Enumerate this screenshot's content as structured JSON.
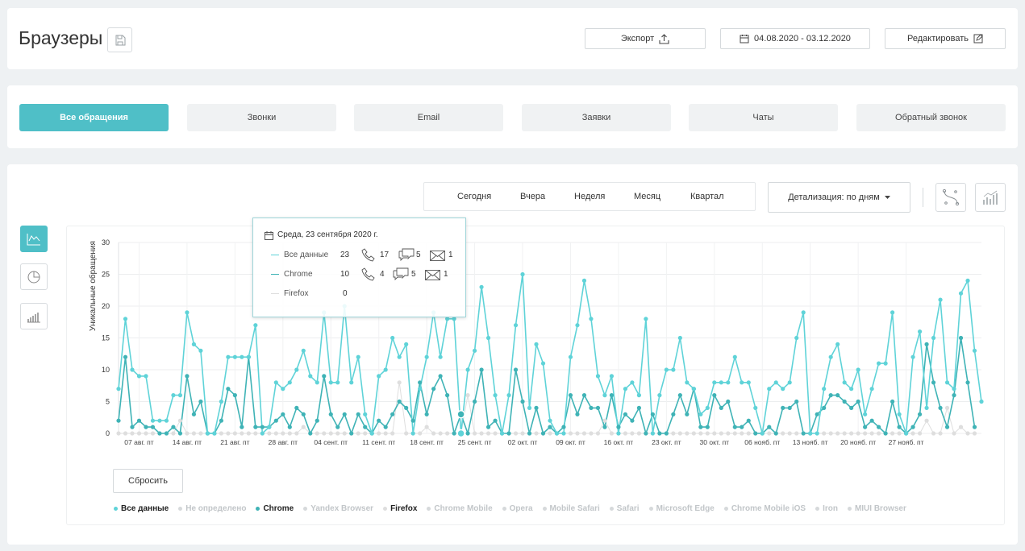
{
  "header": {
    "title": "Браузеры",
    "export_label": "Экспорт",
    "date_range": "04.08.2020 - 03.12.2020",
    "edit_label": "Редактировать"
  },
  "tabs": [
    {
      "label": "Все обращения",
      "active": true
    },
    {
      "label": "Звонки",
      "active": false
    },
    {
      "label": "Email",
      "active": false
    },
    {
      "label": "Заявки",
      "active": false
    },
    {
      "label": "Чаты",
      "active": false
    },
    {
      "label": "Обратный звонок",
      "active": false
    }
  ],
  "periods": [
    "Сегодня",
    "Вчера",
    "Неделя",
    "Месяц",
    "Квартал"
  ],
  "detail_label": "Детализация: по дням",
  "reset_label": "Сбросить",
  "tooltip": {
    "date": "Среда, 23 сентября 2020 г.",
    "rows": [
      {
        "name": "Все данные",
        "total": "23",
        "calls": "17",
        "chats": "5",
        "emails": "1"
      },
      {
        "name": "Chrome",
        "total": "10",
        "calls": "4",
        "chats": "5",
        "emails": "1"
      },
      {
        "name": "Firefox",
        "total": "0"
      }
    ]
  },
  "colors": {
    "accent": "#4fbfc7",
    "all_data": "#5fd3d8",
    "chrome": "#3fb3b6",
    "firefox": "#dedede",
    "inactive": "#d6d9db"
  },
  "legend": [
    {
      "label": "Все данные",
      "active": true,
      "color": "#5fd3d8"
    },
    {
      "label": "Не определено",
      "active": false,
      "color": "#d6d9db"
    },
    {
      "label": "Chrome",
      "active": true,
      "color": "#3fb3b6"
    },
    {
      "label": "Yandex Browser",
      "active": false,
      "color": "#d6d9db"
    },
    {
      "label": "Firefox",
      "active": true,
      "color": "#dedede"
    },
    {
      "label": "Chrome Mobile",
      "active": false,
      "color": "#d6d9db"
    },
    {
      "label": "Opera",
      "active": false,
      "color": "#d6d9db"
    },
    {
      "label": "Mobile Safari",
      "active": false,
      "color": "#d6d9db"
    },
    {
      "label": "Safari",
      "active": false,
      "color": "#d6d9db"
    },
    {
      "label": "Microsoft Edge",
      "active": false,
      "color": "#d6d9db"
    },
    {
      "label": "Chrome Mobile iOS",
      "active": false,
      "color": "#d6d9db"
    },
    {
      "label": "Iron",
      "active": false,
      "color": "#d6d9db"
    },
    {
      "label": "MIUI Browser",
      "active": false,
      "color": "#d6d9db"
    }
  ],
  "chart_data": {
    "type": "line",
    "ylabel": "Уникальные обращения",
    "ylim": [
      0,
      30
    ],
    "yticks": [
      0,
      5,
      10,
      15,
      20,
      25,
      30
    ],
    "xtick_labels": [
      "07 авг. пт",
      "14 авг. пт",
      "21 авг. пт",
      "28 авг. пт",
      "04 сент. пт",
      "11 сент. пт",
      "18 сент. пт",
      "25 сент. пт",
      "02 окт. пт",
      "09 окт. пт",
      "16 окт. пт",
      "23 окт. пт",
      "30 окт. пт",
      "06 нояб. пт",
      "13 нояб. пт",
      "20 нояб. пт",
      "27 нояб. пт"
    ],
    "x_start": "04.08.2020",
    "x_end": "03.12.2020",
    "grid": true,
    "series": [
      {
        "name": "Все данные",
        "values": [
          7,
          18,
          10,
          9,
          9,
          2,
          2,
          2,
          6,
          6,
          19,
          14,
          13,
          0,
          0,
          5,
          12,
          12,
          12,
          12,
          17,
          0,
          1,
          8,
          7,
          8,
          10,
          13,
          9,
          8,
          19,
          8,
          8,
          20,
          8,
          12,
          3,
          0,
          9,
          10,
          15,
          12,
          14,
          0,
          7,
          12,
          19,
          12,
          18,
          18,
          0,
          10,
          13,
          23,
          15,
          6,
          0,
          6,
          17,
          25,
          4,
          14,
          11,
          2,
          0,
          0,
          12,
          17,
          24,
          18,
          9,
          6,
          9,
          0,
          7,
          8,
          6,
          18,
          0,
          6,
          10,
          10,
          15,
          8,
          7,
          3,
          4,
          8,
          8,
          8,
          12,
          8,
          8,
          4,
          0,
          7,
          8,
          7,
          8,
          15,
          19,
          0,
          0,
          7,
          12,
          14,
          8,
          7,
          10,
          3,
          7,
          11,
          11,
          19,
          3,
          0,
          12,
          16,
          4,
          15,
          21,
          8,
          7,
          22,
          24,
          13,
          5
        ]
      },
      {
        "name": "Chrome",
        "values": [
          2,
          12,
          1,
          2,
          1,
          1,
          0,
          0,
          1,
          0,
          9,
          3,
          5,
          0,
          0,
          2,
          7,
          6,
          1,
          12,
          1,
          1,
          1,
          2,
          3,
          1,
          4,
          3,
          0,
          2,
          9,
          3,
          1,
          3,
          0,
          3,
          1,
          0,
          2,
          1,
          3,
          5,
          4,
          2,
          8,
          3,
          7,
          9,
          6,
          0,
          3,
          0,
          5,
          10,
          1,
          2,
          0,
          0,
          10,
          5,
          0,
          4,
          0,
          1,
          0,
          1,
          6,
          3,
          6,
          4,
          4,
          1,
          6,
          1,
          3,
          2,
          4,
          0,
          3,
          0,
          0,
          3,
          6,
          3,
          7,
          1,
          1,
          6,
          4,
          5,
          1,
          1,
          2,
          0,
          0,
          1,
          0,
          4,
          4,
          5,
          0,
          0,
          3,
          4,
          6,
          6,
          5,
          4,
          5,
          1,
          2,
          1,
          0,
          5,
          1,
          0,
          1,
          3,
          14,
          8,
          4,
          1,
          6,
          15,
          8,
          1
        ]
      },
      {
        "name": "Firefox",
        "values": [
          0,
          0,
          0,
          0,
          0,
          0,
          0,
          0,
          0,
          2,
          0,
          0,
          0,
          0,
          0,
          0,
          0,
          0,
          0,
          0,
          0,
          0,
          0,
          0,
          0,
          0,
          0,
          1,
          0,
          0,
          0,
          0,
          0,
          0,
          0,
          0,
          0,
          0,
          0,
          0,
          0,
          8,
          0,
          0,
          0,
          1,
          0,
          0,
          0,
          0,
          0,
          6,
          0,
          0,
          0,
          0,
          0,
          0,
          0,
          0,
          0,
          0,
          0,
          0,
          0,
          0,
          0,
          0,
          0,
          0,
          0,
          2,
          0,
          0,
          0,
          0,
          0,
          0,
          0,
          0,
          0,
          0,
          0,
          0,
          0,
          0,
          0,
          0,
          0,
          0,
          0,
          0,
          0,
          0,
          0,
          0,
          0,
          0,
          0,
          0,
          0,
          0,
          0,
          0,
          0,
          0,
          0,
          0,
          0,
          0,
          0,
          0,
          0,
          0,
          0,
          0,
          0,
          0,
          2,
          0,
          0,
          4,
          0,
          1,
          0,
          0
        ]
      }
    ]
  }
}
